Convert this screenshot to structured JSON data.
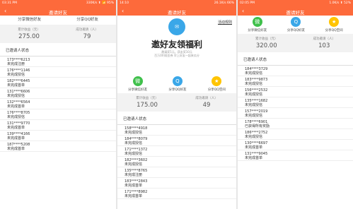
{
  "screen1": {
    "status": {
      "time": "03:31 PM",
      "info": "330K/s ⬆ 📶 95%"
    },
    "title": "邀请好友",
    "share": [
      "分享微信好友",
      "分享QQ好友"
    ],
    "stats": [
      {
        "label": "累计收益（元）",
        "value": "275.00"
      },
      {
        "label": "成功邀请（人）",
        "value": "79"
      }
    ],
    "list_title": "已邀请人状态",
    "rows": [
      {
        "phone": "173****6213",
        "status": "未完成注册"
      },
      {
        "phone": "176****1146",
        "status": "未完成授信"
      },
      {
        "phone": "182****6445",
        "status": "未完成首单"
      },
      {
        "phone": "131****6606",
        "status": "未完成授信"
      },
      {
        "phone": "132****6564",
        "status": "未完成首单"
      },
      {
        "phone": "176****8705",
        "status": "未完成授信"
      },
      {
        "phone": "131****9770",
        "status": "未完成首单"
      },
      {
        "phone": "139****4166",
        "status": "未完成首单"
      },
      {
        "phone": "187****5208",
        "status": "未完成首单"
      }
    ]
  },
  "screen2": {
    "status": {
      "time": "14:10",
      "info": "26.1K/s 66%"
    },
    "title": "邀请好友",
    "rules": "活动规则",
    "hero_title": "邀好友领福利",
    "hero_sub1": "邀请奖5元，获友奖10元",
    "hero_sub2": "百万0利现金券 早上好友一起来瓜分",
    "icons": [
      {
        "name": "微",
        "label": "分享微信好友",
        "color": "green"
      },
      {
        "name": "Q",
        "label": "分享QQ好友",
        "color": "blue"
      },
      {
        "name": "★",
        "label": "分享QQ空间",
        "color": "yellow"
      }
    ],
    "stats": [
      {
        "label": "累计收益（元）",
        "value": "175.00"
      },
      {
        "label": "成功邀请（人）",
        "value": "49"
      }
    ],
    "list_title": "已邀请人状态",
    "rows": [
      {
        "phone": "158****4918",
        "status": "未完成授信"
      },
      {
        "phone": "184****8079",
        "status": "未完成授信"
      },
      {
        "phone": "171****1372",
        "status": "未完成授信"
      },
      {
        "phone": "182****3602",
        "status": "未完成授信"
      },
      {
        "phone": "135****8765",
        "status": "未完成注册"
      },
      {
        "phone": "183****2843",
        "status": "未完成首单"
      },
      {
        "phone": "171****8982",
        "status": "未完成首单"
      }
    ]
  },
  "screen3": {
    "status": {
      "time": "02:05 PM",
      "info": "1.0K/s ⬆ 52%"
    },
    "title": "邀请好友",
    "icons": [
      {
        "name": "微",
        "label": "分享微信好友",
        "color": "green"
      },
      {
        "name": "Q",
        "label": "分享QQ好友",
        "color": "blue"
      },
      {
        "name": "★",
        "label": "分享QQ空间",
        "color": "yellow"
      }
    ],
    "stats": [
      {
        "label": "累计收益（元）",
        "value": "320.00"
      },
      {
        "label": "成功邀请（人）",
        "value": "103"
      }
    ],
    "list_title": "已邀请人状态",
    "rows": [
      {
        "phone": "184****3729",
        "status": "未完成授信"
      },
      {
        "phone": "183****9873",
        "status": "未完成授信"
      },
      {
        "phone": "156****2532",
        "status": "未完成授信"
      },
      {
        "phone": "135****1682",
        "status": "未完成授信"
      },
      {
        "phone": "157****2019",
        "status": "未完成授信"
      },
      {
        "phone": "178****6901",
        "status": "已获得所有奖励"
      },
      {
        "phone": "186****2752",
        "status": "未完成授信"
      },
      {
        "phone": "130****6697",
        "status": "未完成首单"
      },
      {
        "phone": "131****9045",
        "status": "未完成首单"
      }
    ]
  }
}
